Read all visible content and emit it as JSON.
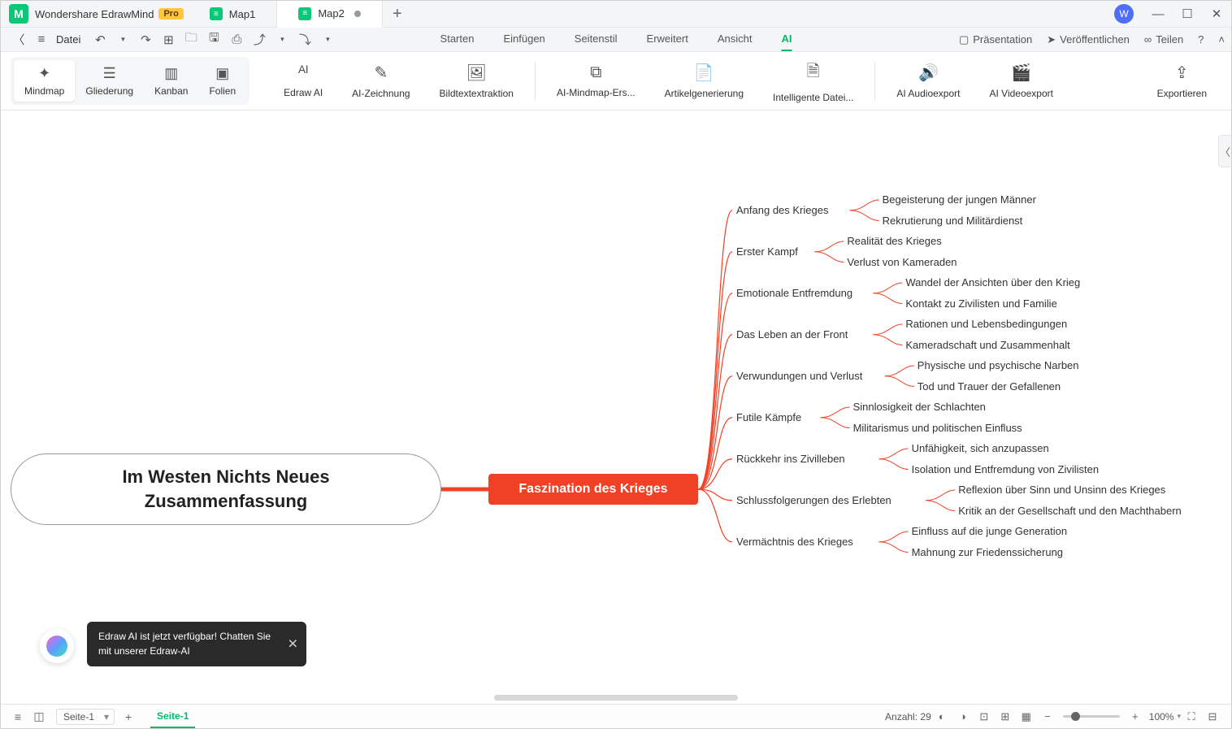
{
  "app": {
    "name": "Wondershare EdrawMind",
    "badge": "Pro",
    "avatar": "W"
  },
  "tabs": [
    {
      "label": "Map1"
    },
    {
      "label": "Map2",
      "active": true,
      "dirty": true
    }
  ],
  "file_label": "Datei",
  "main_tabs": [
    "Starten",
    "Einfügen",
    "Seitenstil",
    "Erweitert",
    "Ansicht",
    "AI"
  ],
  "main_tab_active": 5,
  "top_right": {
    "present": "Präsentation",
    "publish": "Veröffentlichen",
    "share": "Teilen"
  },
  "view_modes": [
    {
      "label": "Mindmap",
      "active": true
    },
    {
      "label": "Gliederung"
    },
    {
      "label": "Kanban"
    },
    {
      "label": "Folien"
    }
  ],
  "ai_tools": [
    "Edraw AI",
    "AI-Zeichnung",
    "Bildtextextraktion",
    "AI-Mindmap-Ers...",
    "Artikelgenerierung",
    "Intelligente Datei...",
    "AI Audioexport",
    "AI Videoexport"
  ],
  "export_label": "Exportieren",
  "mindmap": {
    "root": "Im Westen Nichts Neues Zusammenfassung",
    "main": "Faszination des Krieges",
    "branches": [
      {
        "label": "Anfang des Krieges",
        "children": [
          "Begeisterung der jungen Männer",
          "Rekrutierung und Militärdienst"
        ]
      },
      {
        "label": "Erster Kampf",
        "children": [
          "Realität des Krieges",
          "Verlust von Kameraden"
        ]
      },
      {
        "label": "Emotionale Entfremdung",
        "children": [
          "Wandel der Ansichten über den Krieg",
          "Kontakt zu Zivilisten und Familie"
        ]
      },
      {
        "label": "Das Leben an der Front",
        "children": [
          "Rationen und Lebensbedingungen",
          "Kameradschaft und Zusammenhalt"
        ]
      },
      {
        "label": "Verwundungen und Verlust",
        "children": [
          "Physische und psychische Narben",
          "Tod und Trauer der Gefallenen"
        ]
      },
      {
        "label": "Futile Kämpfe",
        "children": [
          "Sinnlosigkeit der Schlachten",
          "Militarismus und politischen Einfluss"
        ]
      },
      {
        "label": "Rückkehr ins Zivilleben",
        "children": [
          "Unfähigkeit, sich anzupassen",
          "Isolation und Entfremdung von Zivilisten"
        ]
      },
      {
        "label": "Schlussfolgerungen des Erlebten",
        "children": [
          "Reflexion über Sinn und Unsinn des Krieges",
          "Kritik an der Gesellschaft und den Machthabern"
        ]
      },
      {
        "label": "Vermächtnis des Krieges",
        "children": [
          "Einfluss auf die junge Generation",
          "Mahnung zur Friedenssicherung"
        ]
      }
    ]
  },
  "ai_bubble": "Edraw AI ist jetzt verfügbar! Chatten Sie mit unserer Edraw-AI",
  "footer": {
    "page_sel": "Seite-1",
    "page_active": "Seite-1",
    "count_label": "Anzahl:",
    "count": "29",
    "zoom": "100%"
  }
}
